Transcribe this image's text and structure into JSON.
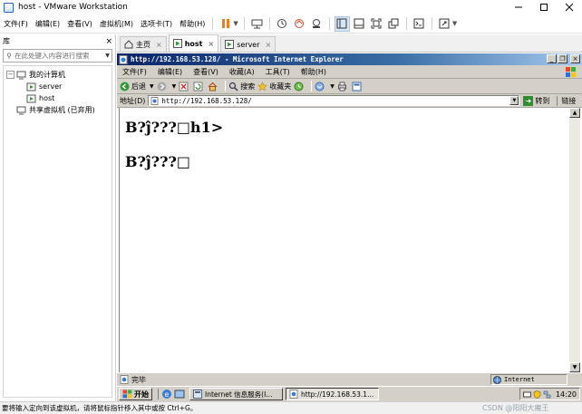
{
  "vmware": {
    "title": "host - VMware Workstation",
    "menu": [
      {
        "id": "file",
        "label": "文件(F)"
      },
      {
        "id": "edit",
        "label": "编辑(E)"
      },
      {
        "id": "view",
        "label": "查看(V)"
      },
      {
        "id": "vm",
        "label": "虚拟机(M)"
      },
      {
        "id": "tabs",
        "label": "选项卡(T)"
      },
      {
        "id": "help",
        "label": "帮助(H)"
      }
    ],
    "library": {
      "title": "库",
      "search_placeholder": "在此处键入内容进行搜索",
      "tree": {
        "my_computer": "我的计算机",
        "vm1": "server",
        "vm2": "host",
        "shared": "共享虚拟机 (已弃用)"
      }
    },
    "tabs": [
      {
        "id": "home",
        "label": "主页"
      },
      {
        "id": "host",
        "label": "host"
      },
      {
        "id": "server",
        "label": "server"
      }
    ],
    "status_text": "要将输入定向到该虚拟机，请将鼠标指针移入其中或按 Ctrl+G。",
    "watermark": "CSDN @阳阳大魔王"
  },
  "ie": {
    "title": "http://192.168.53.128/ - Microsoft Internet Explorer",
    "menu": [
      {
        "id": "file",
        "label": "文件(F)"
      },
      {
        "id": "edit",
        "label": "编辑(E)"
      },
      {
        "id": "view",
        "label": "查看(V)"
      },
      {
        "id": "favorites",
        "label": "收藏(A)"
      },
      {
        "id": "tools",
        "label": "工具(T)"
      },
      {
        "id": "help",
        "label": "帮助(H)"
      }
    ],
    "toolbar": {
      "back": "后退",
      "search": "搜索",
      "favorites": "收藏夹"
    },
    "address": {
      "label": "地址(D)",
      "url": "http://192.168.53.128/",
      "go": "转到",
      "links": "链接"
    },
    "content": {
      "heading": "B?ĵ???□h1>",
      "paragraph": "B?ĵ???□"
    },
    "status": {
      "text": "完毕",
      "zone": "Internet"
    }
  },
  "guest_taskbar": {
    "start": "开始",
    "tasks": [
      {
        "id": "iis",
        "label": "Internet 信息服务(I..."
      },
      {
        "id": "ie",
        "label": "http://192.168.53.1..."
      }
    ],
    "clock": "14:20"
  },
  "colors": {
    "ie_title_start": "#0a246a",
    "ie_title_end": "#a6caf0",
    "classic_face": "#d4d0c8",
    "vmware_accent": "#f07d1a"
  }
}
